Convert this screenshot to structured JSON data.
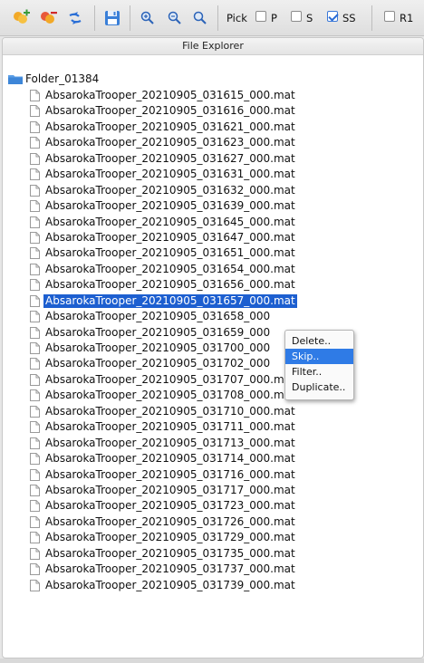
{
  "toolbar": {
    "buttons": [
      {
        "name": "add-icon",
        "color": "#f2a928"
      },
      {
        "name": "remove-icon",
        "color": "#e8593a"
      },
      {
        "name": "refresh-icon",
        "color": "#2b6fd6"
      },
      {
        "name": "save-icon",
        "color": "#3a7fd8"
      },
      {
        "name": "zoom-in-icon"
      },
      {
        "name": "zoom-out-icon"
      },
      {
        "name": "zoom-fit-icon"
      }
    ],
    "pick_label": "Pick",
    "checkboxes": [
      {
        "label": "P",
        "checked": false
      },
      {
        "label": "S",
        "checked": false
      },
      {
        "label": "SS",
        "checked": true
      },
      {
        "label": "R1",
        "checked": false
      }
    ]
  },
  "explorer": {
    "title": "File Explorer",
    "folder": "Folder_01384",
    "files": [
      "AbsarokaTrooper_20210905_031615_000.mat",
      "AbsarokaTrooper_20210905_031616_000.mat",
      "AbsarokaTrooper_20210905_031621_000.mat",
      "AbsarokaTrooper_20210905_031623_000.mat",
      "AbsarokaTrooper_20210905_031627_000.mat",
      "AbsarokaTrooper_20210905_031631_000.mat",
      "AbsarokaTrooper_20210905_031632_000.mat",
      "AbsarokaTrooper_20210905_031639_000.mat",
      "AbsarokaTrooper_20210905_031645_000.mat",
      "AbsarokaTrooper_20210905_031647_000.mat",
      "AbsarokaTrooper_20210905_031651_000.mat",
      "AbsarokaTrooper_20210905_031654_000.mat",
      "AbsarokaTrooper_20210905_031656_000.mat",
      "AbsarokaTrooper_20210905_031657_000.mat",
      "AbsarokaTrooper_20210905_031658_000",
      "AbsarokaTrooper_20210905_031659_000",
      "AbsarokaTrooper_20210905_031700_000",
      "AbsarokaTrooper_20210905_031702_000",
      "AbsarokaTrooper_20210905_031707_000.mat",
      "AbsarokaTrooper_20210905_031708_000.mat",
      "AbsarokaTrooper_20210905_031710_000.mat",
      "AbsarokaTrooper_20210905_031711_000.mat",
      "AbsarokaTrooper_20210905_031713_000.mat",
      "AbsarokaTrooper_20210905_031714_000.mat",
      "AbsarokaTrooper_20210905_031716_000.mat",
      "AbsarokaTrooper_20210905_031717_000.mat",
      "AbsarokaTrooper_20210905_031723_000.mat",
      "AbsarokaTrooper_20210905_031726_000.mat",
      "AbsarokaTrooper_20210905_031729_000.mat",
      "AbsarokaTrooper_20210905_031735_000.mat",
      "AbsarokaTrooper_20210905_031737_000.mat",
      "AbsarokaTrooper_20210905_031739_000.mat"
    ],
    "selected_file": "AbsarokaTrooper_20210905_031657_000.mat",
    "selection_color": "#1d5fd0"
  },
  "context_menu": {
    "items": [
      "Delete..",
      "Skip..",
      "Filter..",
      "Duplicate.."
    ],
    "highlighted": "Skip..",
    "highlight_color": "#2f7be6"
  }
}
